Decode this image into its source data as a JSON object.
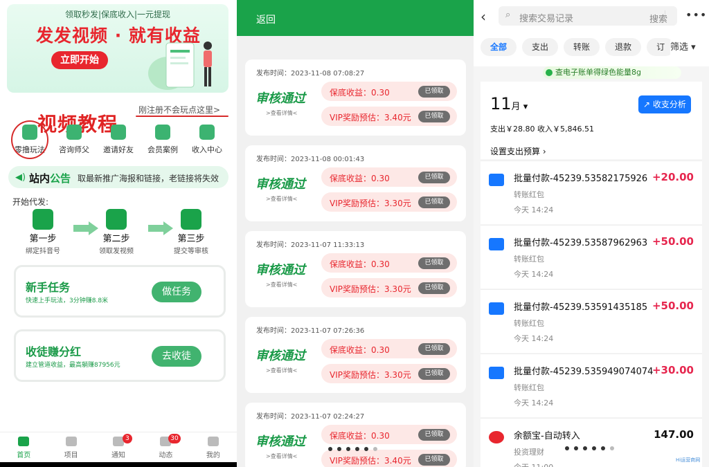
{
  "left": {
    "banner": {
      "subtitle": "领取秒发|保底收入|一元提现",
      "title": "发发视频 · 就有收益",
      "cta": "立即开始"
    },
    "tutorial_link": "刚注册不会玩点这里>",
    "video_tutorial": "视频教程",
    "quick_menu": [
      {
        "label": "零撸玩法",
        "icon": "zero-play-icon"
      },
      {
        "label": "咨询师父",
        "icon": "consult-icon"
      },
      {
        "label": "邀请好友",
        "icon": "invite-icon"
      },
      {
        "label": "会员案例",
        "icon": "cases-icon"
      },
      {
        "label": "收入中心",
        "icon": "income-icon"
      }
    ],
    "notice": {
      "title_a": "站内",
      "title_b": "公告",
      "text": "取最新推广海报和链接，老链接将失效"
    },
    "start_label": "开始代发:",
    "steps": [
      {
        "title": "第一步",
        "sub": "绑定抖音号"
      },
      {
        "title": "第二步",
        "sub": "领取发视频"
      },
      {
        "title": "第三步",
        "sub": "提交等审核"
      }
    ],
    "tasks": [
      {
        "title": "新手任务",
        "sub": "快速上手玩法，3分钟赚8.8米",
        "button": "做任务"
      },
      {
        "title": "收徒赚分红",
        "sub": "建立管道收益，最高躺赚87956元",
        "button": "去收徒"
      }
    ],
    "tabs": [
      {
        "label": "首页",
        "active": true,
        "badge": ""
      },
      {
        "label": "项目",
        "active": false,
        "badge": ""
      },
      {
        "label": "通知",
        "active": false,
        "badge": "3"
      },
      {
        "label": "动态",
        "active": false,
        "badge": "30"
      },
      {
        "label": "我的",
        "active": false,
        "badge": ""
      }
    ]
  },
  "mid": {
    "back": "返回",
    "cards": [
      {
        "time": "发布时间：2023-11-08 07:08:27",
        "stamp": "审核通过",
        "detail": ">查看详情<",
        "base": "保底收益：0.30",
        "vip": "VIP奖励预估：3.40元",
        "claimed": "已领取"
      },
      {
        "time": "发布时间：2023-11-08 00:01:43",
        "stamp": "审核通过",
        "detail": ">查看详情<",
        "base": "保底收益：0.30",
        "vip": "VIP奖励预估：3.30元",
        "claimed": "已领取"
      },
      {
        "time": "发布时间：2023-11-07 11:33:13",
        "stamp": "审核通过",
        "detail": ">查看详情<",
        "base": "保底收益：0.30",
        "vip": "VIP奖励预估：3.30元",
        "claimed": "已领取"
      },
      {
        "time": "发布时间：2023-11-07 07:26:36",
        "stamp": "审核通过",
        "detail": ">查看详情<",
        "base": "保底收益：0.30",
        "vip": "VIP奖励预估：3.30元",
        "claimed": "已领取"
      },
      {
        "time": "发布时间：2023-11-07 02:24:27",
        "stamp": "审核通过",
        "detail": ">查看详情<",
        "base": "保底收益：0.30",
        "vip": "VIP奖励预估：3.40元",
        "claimed": "已领取"
      }
    ]
  },
  "right": {
    "search_placeholder": "搜索交易记录",
    "search_button": "搜索",
    "chips": [
      "全部",
      "支出",
      "转账",
      "退款",
      "订"
    ],
    "filter": "筛选",
    "energy": "查电子账单得绿色能量8g",
    "month": "11",
    "month_unit": "月",
    "analysis": "收支分析",
    "totals": "支出￥28.80    收入￥5,846.51",
    "budget": "设置支出预算",
    "items": [
      {
        "title": "批量付款-45239.53582175926",
        "cat": "转账红包",
        "time": "今天 14:24",
        "amount": "+20.00",
        "icon": "transfer-icon"
      },
      {
        "title": "批量付款-45239.53587962963",
        "cat": "转账红包",
        "time": "今天 14:24",
        "amount": "+50.00",
        "icon": "transfer-icon"
      },
      {
        "title": "批量付款-45239.53591435185",
        "cat": "转账红包",
        "time": "今天 14:24",
        "amount": "+50.00",
        "icon": "transfer-icon"
      },
      {
        "title": "批量付款-45239.535949074074",
        "cat": "转账红包",
        "time": "今天 14:24",
        "amount": "+30.00",
        "icon": "transfer-icon"
      },
      {
        "title": "余额宝-自动转入",
        "cat": "投资理财",
        "time": "今天 11:00",
        "amount": "147.00",
        "icon": "yuebao-icon"
      }
    ],
    "watermark": "Hi运营商网"
  },
  "colors": {
    "green": "#1aa34a",
    "red": "#e8262e",
    "blue": "#1677ff"
  }
}
